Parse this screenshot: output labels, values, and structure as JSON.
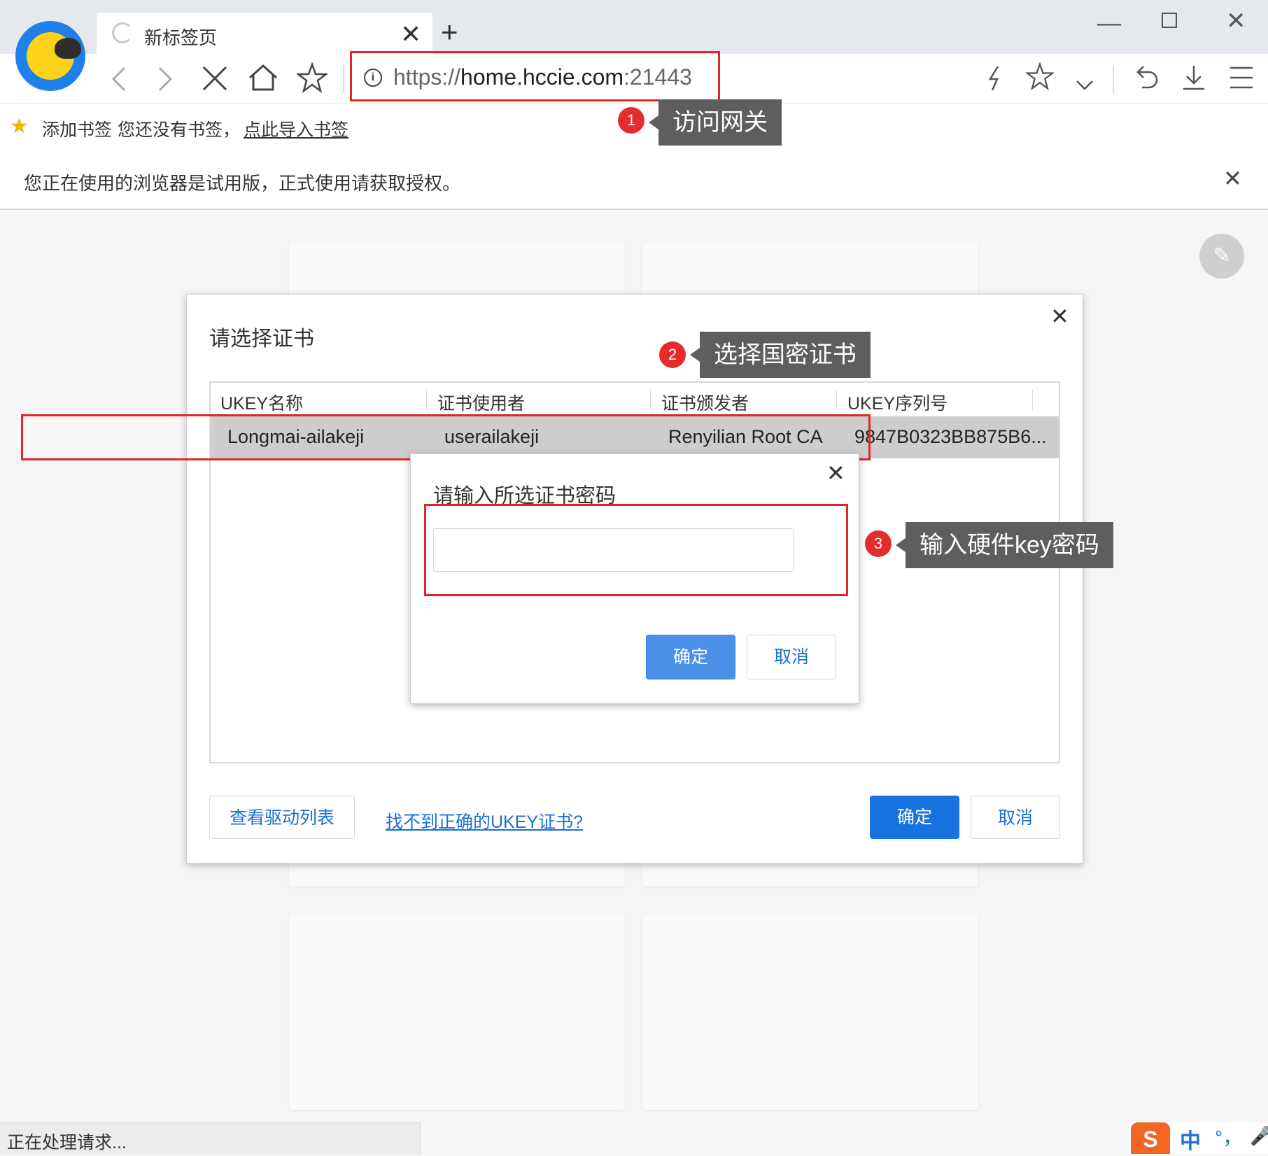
{
  "browser": {
    "tab_title": "新标签页",
    "tab_close": "✕",
    "new_tab": "+",
    "window_min": "—",
    "window_close": "✕",
    "url_scheme": "https://",
    "url_host": "home.hccie.com",
    "url_port": ":21443",
    "url_info_icon": "i"
  },
  "nav_icons": [
    "back-icon",
    "forward-icon",
    "stop-icon",
    "home-icon",
    "star-icon",
    "lightning-icon",
    "favorite-icon",
    "chevron-down-icon",
    "undo-icon",
    "download-icon",
    "menu-icon"
  ],
  "bookmarks": {
    "add_label": "添加书签",
    "empty_text": "您还没有书签，",
    "import_link": "点此导入书签"
  },
  "infobar": {
    "text": "您正在使用的浏览器是试用版，正式使用请获取授权。",
    "close": "✕"
  },
  "callouts": [
    {
      "num": "1",
      "text": "访问网关"
    },
    {
      "num": "2",
      "text": "选择国密证书"
    },
    {
      "num": "3",
      "text": "输入硬件key密码"
    }
  ],
  "cert_dialog": {
    "title": "请选择证书",
    "close": "✕",
    "columns": [
      "UKEY名称",
      "证书使用者",
      "证书颁发者",
      "UKEY序列号"
    ],
    "rows": [
      {
        "ukey_name": "Longmai-ailakeji",
        "subject": "userailakeji",
        "issuer": "Renyilian Root CA",
        "serial": "9847B0323BB875B6..."
      }
    ],
    "driver_list_button": "查看驱动列表",
    "help_link": "找不到正确的UKEY证书?",
    "ok_button": "确定",
    "cancel_button": "取消"
  },
  "password_dialog": {
    "title": "请输入所选证书密码",
    "close": "✕",
    "input_value": "",
    "ok_button": "确定",
    "cancel_button": "取消"
  },
  "status_bar": {
    "text": "正在处理请求..."
  },
  "ime": {
    "logo": "S",
    "mode": "中",
    "punct": "°，",
    "mic": "🎤"
  },
  "colors": {
    "accent_blue": "#1872e0",
    "highlight_red": "#e0262a",
    "callout_bg": "#5e5e5e",
    "badge_red": "#e52b2b"
  }
}
